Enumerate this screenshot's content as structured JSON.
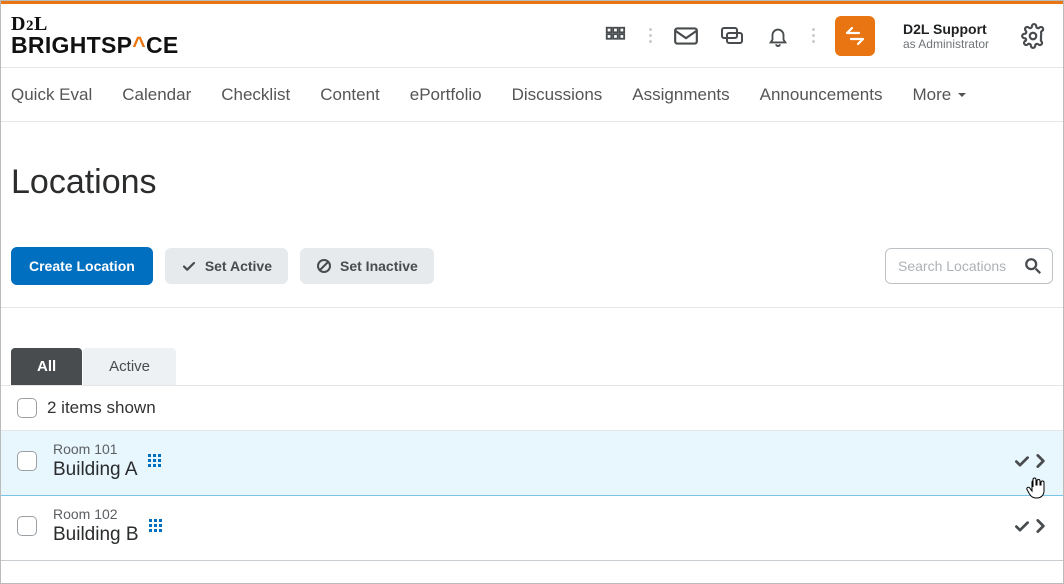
{
  "header": {
    "user_name": "D2L Support",
    "user_role": "as Administrator"
  },
  "nav": {
    "items": [
      "Quick Eval",
      "Calendar",
      "Checklist",
      "Content",
      "ePortfolio",
      "Discussions",
      "Assignments",
      "Announcements"
    ],
    "more_label": "More"
  },
  "page": {
    "title": "Locations"
  },
  "toolbar": {
    "create_label": "Create Location",
    "set_active_label": "Set Active",
    "set_inactive_label": "Set Inactive",
    "search_placeholder": "Search Locations"
  },
  "tabs": {
    "all": "All",
    "active": "Active"
  },
  "list": {
    "count_text": "2 items shown",
    "rows": [
      {
        "name": "Room 101",
        "building": "Building A"
      },
      {
        "name": "Room 102",
        "building": "Building B"
      }
    ]
  }
}
